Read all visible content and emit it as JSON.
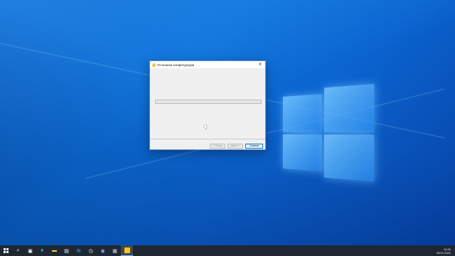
{
  "dialog": {
    "title": "Установка конфигурации",
    "close_glyph": "✕",
    "progress": 0,
    "buttons": {
      "back": "< Назад",
      "next": "Далее >",
      "cancel": "Отмена"
    }
  },
  "taskbar": {
    "items": [
      {
        "name": "start-button-icon",
        "glyph": ""
      },
      {
        "name": "search-icon",
        "glyph": "⌕"
      },
      {
        "name": "task-view-icon",
        "glyph": "▣"
      },
      {
        "name": "edge-icon",
        "glyph": "e"
      },
      {
        "name": "file-explorer-icon",
        "glyph": "▬"
      },
      {
        "name": "store-icon",
        "glyph": "▤"
      },
      {
        "name": "mail-icon",
        "glyph": "✉"
      },
      {
        "name": "clock-icon",
        "glyph": "◷"
      },
      {
        "name": "app-icon",
        "glyph": "◉"
      },
      {
        "name": "image-app-icon",
        "glyph": "▦"
      },
      {
        "name": "1c-app-icon",
        "glyph": "1C"
      }
    ],
    "clock": {
      "time": "14:24",
      "date": "28.01.2021"
    }
  },
  "colors": {
    "accent": "#0078d7",
    "taskbar": "#1f2733",
    "desktop": "#0b63cf"
  }
}
